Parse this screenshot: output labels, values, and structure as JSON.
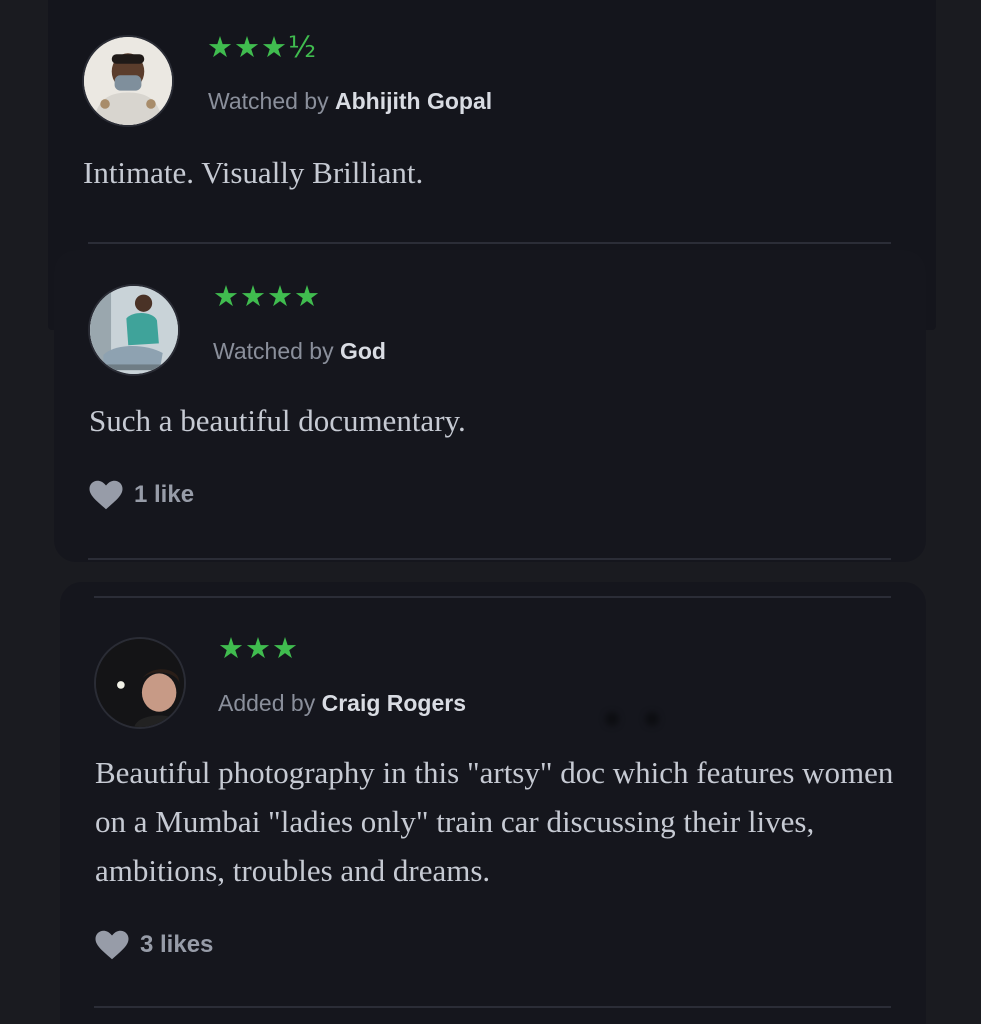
{
  "colors": {
    "background": "#1a1b20",
    "card": "#15161d",
    "star_green": "#40bc4f",
    "text_muted": "#8a8f9b",
    "text_user": "#d9dce3",
    "text_review": "#c6cad3"
  },
  "reviews": [
    {
      "stars": "★★★½",
      "rating": 3.5,
      "action_prefix": "Watched by",
      "user": "Abhijith Gopal",
      "text": "Intimate. Visually Brilliant.",
      "likes": ""
    },
    {
      "stars": "★★★★",
      "rating": 4,
      "action_prefix": "Watched by",
      "user": "God",
      "text": "Such a beautiful documentary.",
      "likes": "1 like",
      "like_icon": "heart-icon"
    },
    {
      "stars": "★★★",
      "rating": 3,
      "action_prefix": "Added by",
      "user": "Craig Rogers",
      "text": "Beautiful photography in this \"artsy\" doc which features women on a Mumbai \"ladies only\" train car discussing their lives, ambitions, troubles and dreams.",
      "likes": "3 likes",
      "like_icon": "heart-icon"
    }
  ]
}
